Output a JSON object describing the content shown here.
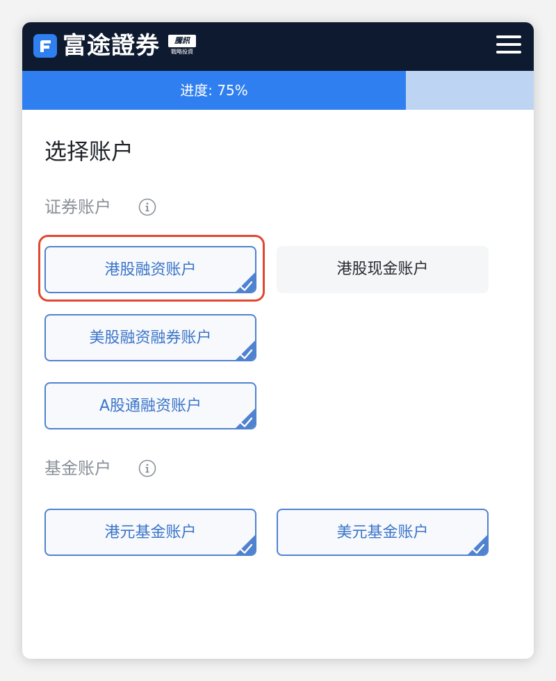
{
  "header": {
    "logo_text": "富途證券",
    "partner_badge": "騰訊",
    "partner_sub": "戰略投資",
    "menu_icon": "hamburger-menu-icon"
  },
  "progress": {
    "label": "进度: 75%",
    "percent": 75,
    "fill_color": "#2f7ff0",
    "track_color": "#bdd5f3"
  },
  "page": {
    "title": "选择账户"
  },
  "securities": {
    "label": "证券账户",
    "info_icon": "info-circle-icon",
    "accounts": [
      {
        "label": "港股融资账户",
        "selected": true,
        "highlighted": true
      },
      {
        "label": "港股现金账户",
        "selected": false
      },
      {
        "label": "美股融资融券账户",
        "selected": true
      },
      {
        "label": "A股通融资账户",
        "selected": true
      }
    ]
  },
  "funds": {
    "label": "基金账户",
    "info_icon": "info-circle-icon",
    "accounts": [
      {
        "label": "港元基金账户",
        "selected": true
      },
      {
        "label": "美元基金账户",
        "selected": true
      }
    ]
  },
  "colors": {
    "header_bg": "#0e1a2f",
    "accent": "#2f7ff0",
    "selected_border": "#4f82cf",
    "highlight_ring": "#e2462f"
  }
}
